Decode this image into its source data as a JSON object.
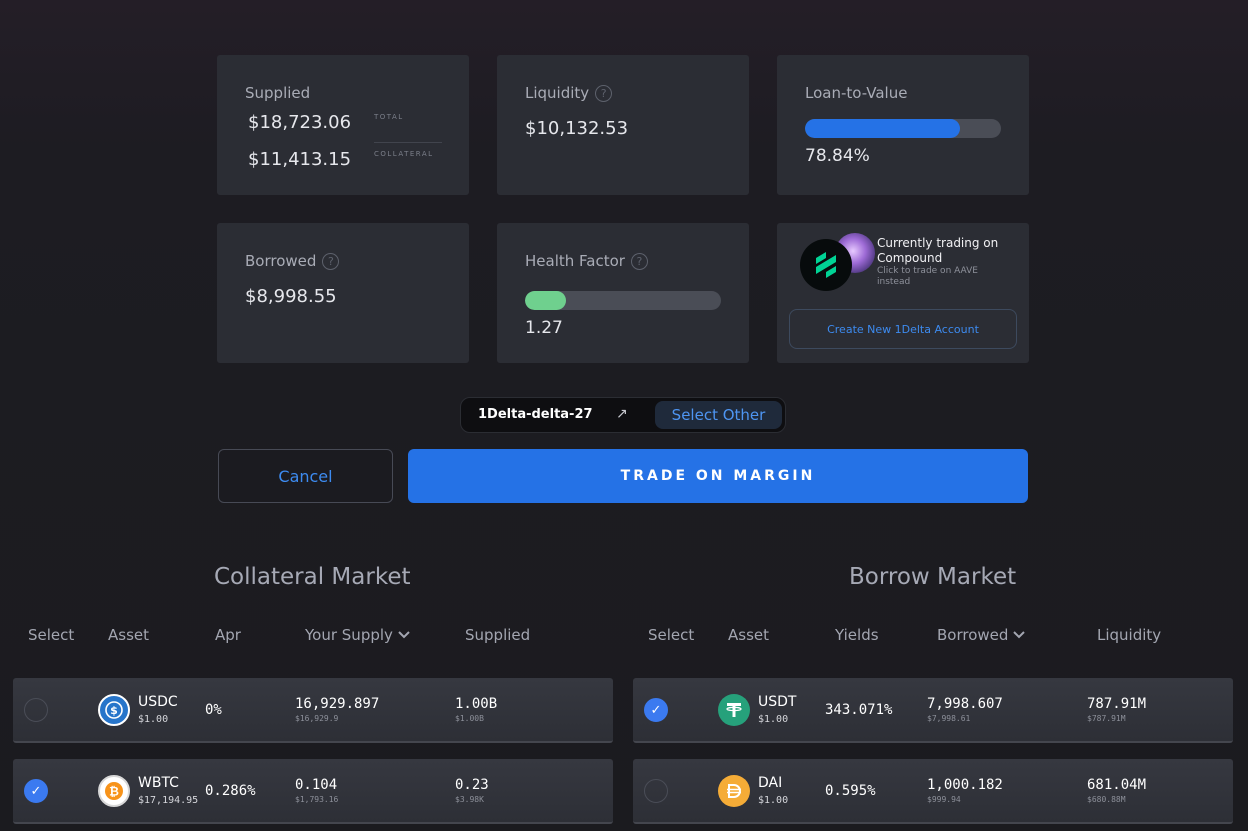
{
  "cards": {
    "supplied": {
      "title": "Supplied",
      "total": "$18,723.06",
      "total_tag": "TOTAL",
      "collateral": "$11,413.15",
      "collateral_tag": "COLLATERAL"
    },
    "liquidity": {
      "title": "Liquidity",
      "value": "$10,132.53"
    },
    "ltv": {
      "title": "Loan-to-Value",
      "value": "78.84%",
      "fill_fraction": 0.7884
    },
    "borrowed": {
      "title": "Borrowed",
      "value": "$8,998.55"
    },
    "health": {
      "title": "Health Factor",
      "value": "1.27",
      "fill_fraction": 0.21
    },
    "protocol": {
      "line1": "Currently trading on",
      "line2": "Compound",
      "sub1": "Click to trade on AAVE",
      "sub2": "instead",
      "create_label": "Create New 1Delta Account"
    }
  },
  "account": {
    "name": "1Delta-delta-27",
    "select_other": "Select Other"
  },
  "actions": {
    "cancel": "Cancel",
    "trade": "TRADE ON MARGIN"
  },
  "collateral_market": {
    "title": "Collateral Market",
    "headers": {
      "select": "Select",
      "asset": "Asset",
      "apr": "Apr",
      "your_supply": "Your Supply",
      "supplied": "Supplied"
    },
    "rows": [
      {
        "symbol": "USDC",
        "price": "$1.00",
        "apr": "0%",
        "supply": "16,929.897",
        "supply_usd": "$16,929.9",
        "supplied": "1.00B",
        "supplied_usd": "$1.00B",
        "selected": false
      },
      {
        "symbol": "WBTC",
        "price": "$17,194.95",
        "apr": "0.286%",
        "supply": "0.104",
        "supply_usd": "$1,793.16",
        "supplied": "0.23",
        "supplied_usd": "$3.98K",
        "selected": true
      }
    ]
  },
  "borrow_market": {
    "title": "Borrow Market",
    "headers": {
      "select": "Select",
      "asset": "Asset",
      "yields": "Yields",
      "borrowed": "Borrowed",
      "liquidity": "Liquidity"
    },
    "rows": [
      {
        "symbol": "USDT",
        "price": "$1.00",
        "yields": "343.071%",
        "borrowed": "7,998.607",
        "borrowed_usd": "$7,998.61",
        "liquidity": "787.91M",
        "liquidity_usd": "$787.91M",
        "selected": true
      },
      {
        "symbol": "DAI",
        "price": "$1.00",
        "yields": "0.595%",
        "borrowed": "1,000.182",
        "borrowed_usd": "$999.94",
        "liquidity": "681.04M",
        "liquidity_usd": "$680.88M",
        "selected": false
      }
    ]
  },
  "colors": {
    "accent": "#2572e6",
    "ltv_bar": "#2572e6",
    "health_bar": "#6fd08e",
    "usdc": "#2775ca",
    "usdt": "#26a17b",
    "dai": "#f5ac37",
    "wbtc": "#f7931a"
  },
  "glyphs": {
    "check": "✓",
    "chevron": "⌄",
    "help": "?",
    "external": "↗"
  }
}
